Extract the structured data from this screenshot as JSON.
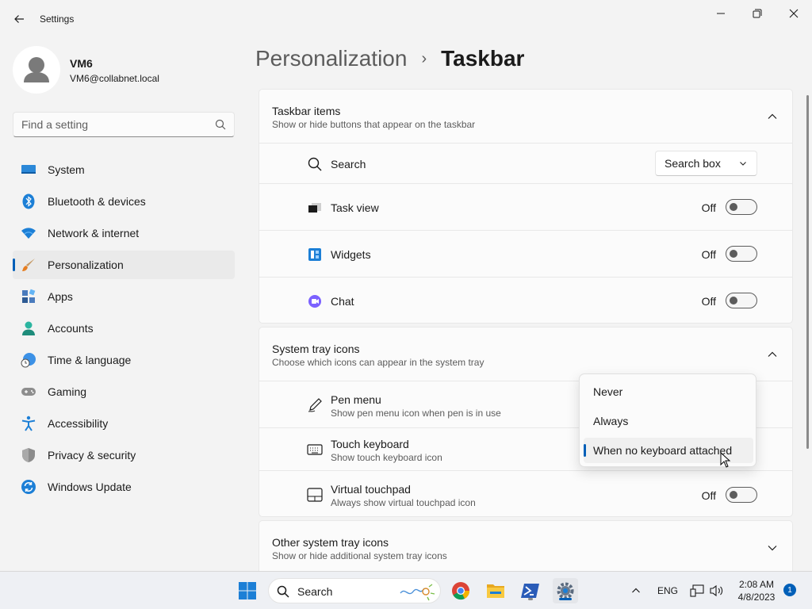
{
  "window": {
    "app_title": "Settings"
  },
  "profile": {
    "name": "VM6",
    "email": "VM6@collabnet.local"
  },
  "search": {
    "placeholder": "Find a setting"
  },
  "nav": {
    "items": [
      {
        "label": "System",
        "icon": "system-icon"
      },
      {
        "label": "Bluetooth & devices",
        "icon": "bluetooth-icon"
      },
      {
        "label": "Network & internet",
        "icon": "wifi-icon"
      },
      {
        "label": "Personalization",
        "icon": "brush-icon",
        "active": true
      },
      {
        "label": "Apps",
        "icon": "apps-icon"
      },
      {
        "label": "Accounts",
        "icon": "accounts-icon"
      },
      {
        "label": "Time & language",
        "icon": "time-language-icon"
      },
      {
        "label": "Gaming",
        "icon": "gaming-icon"
      },
      {
        "label": "Accessibility",
        "icon": "accessibility-icon"
      },
      {
        "label": "Privacy & security",
        "icon": "shield-icon"
      },
      {
        "label": "Windows Update",
        "icon": "update-icon"
      }
    ]
  },
  "header": {
    "parent": "Personalization",
    "separator": "›",
    "current": "Taskbar"
  },
  "taskbar_items": {
    "title": "Taskbar items",
    "subtitle": "Show or hide buttons that appear on the taskbar",
    "rows": [
      {
        "label": "Search",
        "icon": "search-icon",
        "control": "combo",
        "value": "Search box"
      },
      {
        "label": "Task view",
        "icon": "task-view-icon",
        "control": "toggle",
        "state": "Off"
      },
      {
        "label": "Widgets",
        "icon": "widgets-icon",
        "control": "toggle",
        "state": "Off"
      },
      {
        "label": "Chat",
        "icon": "chat-icon",
        "control": "toggle",
        "state": "Off"
      }
    ]
  },
  "system_tray": {
    "title": "System tray icons",
    "subtitle": "Choose which icons can appear in the system tray",
    "rows": [
      {
        "label": "Pen menu",
        "sub": "Show pen menu icon when pen is in use",
        "icon": "pen-icon"
      },
      {
        "label": "Touch keyboard",
        "sub": "Show touch keyboard icon",
        "icon": "keyboard-icon"
      },
      {
        "label": "Virtual touchpad",
        "sub": "Always show virtual touchpad icon",
        "icon": "touchpad-icon",
        "state": "Off"
      }
    ]
  },
  "dropdown": {
    "options": [
      "Never",
      "Always",
      "When no keyboard attached"
    ],
    "selected": "When no keyboard attached"
  },
  "other_tray": {
    "title": "Other system tray icons",
    "subtitle": "Show or hide additional system tray icons"
  },
  "taskbar": {
    "search_label": "Search",
    "language": "ENG",
    "time": "2:08 AM",
    "date": "4/8/2023",
    "notifications": "1"
  },
  "colors": {
    "accent": "#005fb8",
    "background": "#f3f3f3",
    "card": "#fbfbfb"
  }
}
